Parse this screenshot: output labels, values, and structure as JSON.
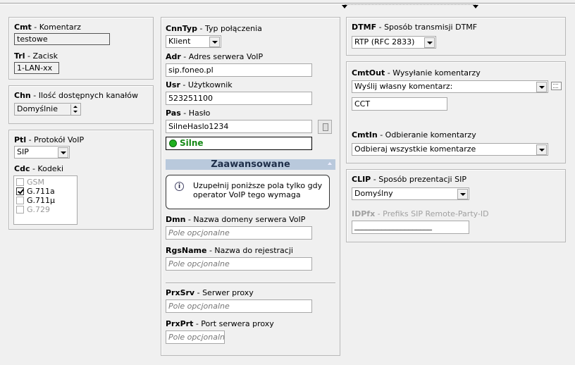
{
  "left": {
    "cmt": {
      "code": "Cmt",
      "desc": " - Komentarz",
      "value": "testowe"
    },
    "trl": {
      "code": "Trl",
      "desc": " - Zacisk",
      "value": "1-LAN-xx"
    },
    "chn": {
      "code": "Chn",
      "desc": " - Ilość dostępnych kanałów",
      "value": "Domyślnie"
    },
    "ptl": {
      "code": "Ptl",
      "desc": " - Protokół VoIP",
      "value": "SIP"
    },
    "cdc": {
      "code": "Cdc",
      "desc": " - Kodeki"
    },
    "codecs": [
      {
        "name": "GSM",
        "checked": false,
        "enabled": false
      },
      {
        "name": "G.711a",
        "checked": true,
        "enabled": true
      },
      {
        "name": "G.711µ",
        "checked": false,
        "enabled": true
      },
      {
        "name": "G.729",
        "checked": false,
        "enabled": false
      }
    ]
  },
  "middle": {
    "cnntyp": {
      "code": "CnnTyp",
      "desc": " - Typ połączenia",
      "value": "Klient"
    },
    "adr": {
      "code": "Adr",
      "desc": " - Adres serwera VoIP",
      "value": "sip.foneo.pl"
    },
    "usr": {
      "code": "Usr",
      "desc": " - Użytkownik",
      "value": "523251100"
    },
    "pas": {
      "code": "Pas",
      "desc": " - Hasło",
      "value": "SilneHaslo1234"
    },
    "strength": "Silne",
    "advanced_label": "Zaawansowane",
    "info_text": "Uzupełnij poniższe pola tylko gdy operator VoIP tego wymaga",
    "dmn": {
      "code": "Dmn",
      "desc": " - Nazwa domeny serwera VoIP",
      "placeholder": "Pole opcjonalne"
    },
    "rgsname": {
      "code": "RgsName",
      "desc": " - Nazwa do rejestracji",
      "placeholder": "Pole opcjonalne"
    },
    "prxsrv": {
      "code": "PrxSrv",
      "desc": " - Serwer proxy",
      "placeholder": "Pole opcjonalne"
    },
    "prxprt": {
      "code": "PrxPrt",
      "desc": " - Port serwera proxy",
      "placeholder": "Pole opcjonalne"
    }
  },
  "right": {
    "dtmf": {
      "code": "DTMF",
      "desc": " - Sposób transmisji DTMF",
      "value": "RTP (RFC 2833)"
    },
    "cmtout": {
      "code": "CmtOut",
      "desc": " - Wysyłanie komentarzy",
      "value": "Wyślij własny komentarz:",
      "text": "CCT"
    },
    "cmtin": {
      "code": "CmtIn",
      "desc": " - Odbieranie komentarzy",
      "value": "Odbieraj wszystkie komentarze"
    },
    "clip": {
      "code": "CLIP",
      "desc": " - Sposób prezentacji SIP",
      "value": "Domyślny"
    },
    "idpfx": {
      "code": "IDPfx",
      "desc": " - Prefiks SIP Remote-Party-ID",
      "value": "____________________"
    }
  }
}
